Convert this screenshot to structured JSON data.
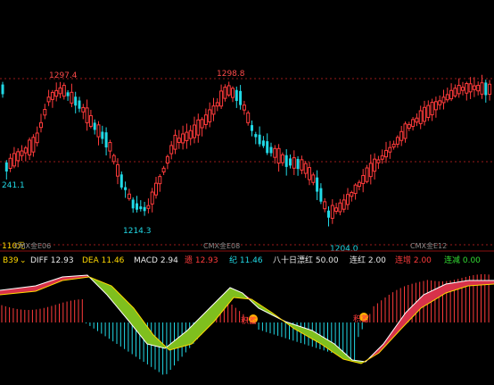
{
  "price_chart": {
    "annotations": {
      "high1": "1297.4",
      "high2": "1298.8",
      "low_left": "241.1",
      "low1": "1214.3",
      "low2": "1204.0"
    },
    "bottom_labels": {
      "left_value": "110元",
      "period1": "CMX金E06",
      "period2": "CMX金E08",
      "period3": "CMX金E12"
    }
  },
  "indicator_bar": {
    "name": "B39",
    "diff_label": "DIFF 12.93",
    "dea_label": "DEA 11.46",
    "macd_label": "MACD 2.94",
    "red_label": "遗 12.93",
    "green_label": "纪 11.46",
    "mid_label": "八十日漂红 50.00",
    "lianhong_label": "连红 2.00",
    "lianzeng_label": "连增 2.00",
    "lianjian_label": "连减 0.00"
  },
  "markers": {
    "m1": "积蓄",
    "m2": "积蓄"
  },
  "colors": {
    "up": "#ff3b3b",
    "down": "#21d9e6",
    "grid": "#9a1a1a",
    "yellow": "#ffd800",
    "green_fill": "#7fbf1e",
    "red_fill": "#d8324a"
  }
}
